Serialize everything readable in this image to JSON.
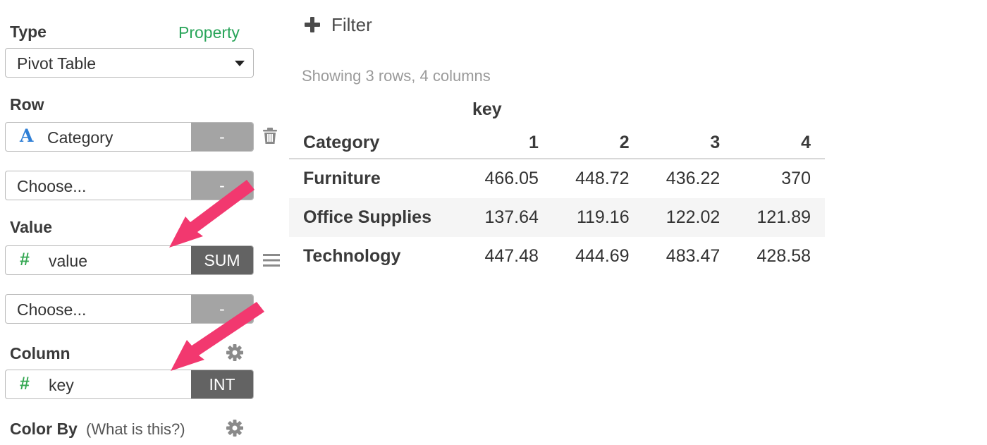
{
  "sidebar": {
    "type_label": "Type",
    "property_link": "Property",
    "type_select": "Pivot Table",
    "row_label": "Row",
    "row_fields": [
      {
        "name": "Category",
        "agg": "-",
        "icon": "text-type-icon"
      },
      {
        "name": "Choose...",
        "agg": "-"
      }
    ],
    "value_label": "Value",
    "value_fields": [
      {
        "name": "value",
        "agg": "SUM",
        "icon": "number-type-icon"
      },
      {
        "name": "Choose...",
        "agg": "-"
      }
    ],
    "column_label": "Column",
    "column_field": {
      "name": "key",
      "agg": "INT",
      "icon": "number-type-icon"
    },
    "color_by_label": "Color By",
    "color_by_help": "(What is this?)",
    "type_a_glyph": "A",
    "type_hash_glyph": "#"
  },
  "main": {
    "filter_label": "Filter",
    "summary": "Showing 3 rows, 4 columns",
    "table": {
      "column_group": "key",
      "row_header": "Category",
      "columns": [
        "1",
        "2",
        "3",
        "4"
      ],
      "rows": [
        {
          "label": "Furniture",
          "values": [
            "466.05",
            "448.72",
            "436.22",
            "370"
          ]
        },
        {
          "label": "Office Supplies",
          "values": [
            "137.64",
            "119.16",
            "122.02",
            "121.89"
          ]
        },
        {
          "label": "Technology",
          "values": [
            "447.48",
            "444.69",
            "483.47",
            "428.58"
          ]
        }
      ]
    }
  },
  "colors": {
    "accent_green": "#2aa55a",
    "annotation_arrow": "#f2386f",
    "agg_light": "#a4a4a4",
    "agg_dark": "#636363"
  }
}
